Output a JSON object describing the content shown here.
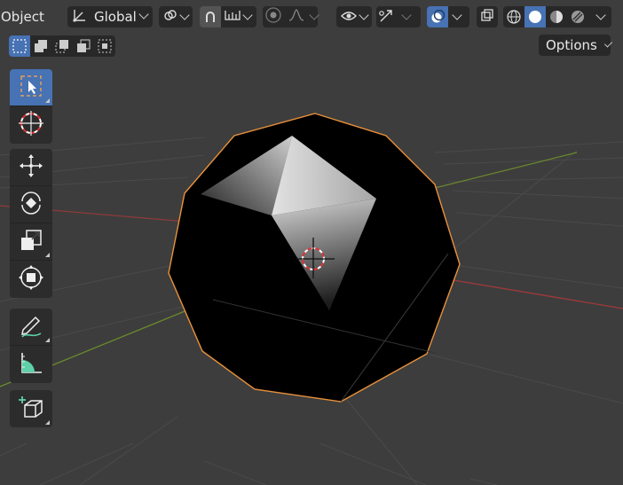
{
  "header": {
    "mode_label": "Object",
    "orientation_label": "Global",
    "options_label": "Options"
  },
  "colors": {
    "accent": "#4772b3",
    "viewport_bg": "#3d3d3d",
    "selection_outline": "#e8913a",
    "x_axis": "#a23a3a",
    "y_axis": "#6b8a2c"
  },
  "icons": {
    "transform_orientation": "orientation-axes-icon",
    "pivot": "pivot-link-icon",
    "snap": "magnet-icon",
    "snap_target": "snap-increment-icon",
    "proportional": "proportional-edit-icon",
    "falloff": "falloff-curve-icon",
    "visibility": "eye-icon",
    "gizmo": "gizmo-icon",
    "overlays": "overlays-icon",
    "xray": "xray-icon",
    "shading": [
      "wireframe-icon",
      "solid-icon",
      "material-icon",
      "rendered-icon"
    ]
  },
  "toolbar": {
    "tools": [
      "select-box",
      "cursor",
      "move",
      "rotate",
      "scale",
      "transform",
      "annotate",
      "measure",
      "add-cube"
    ]
  }
}
